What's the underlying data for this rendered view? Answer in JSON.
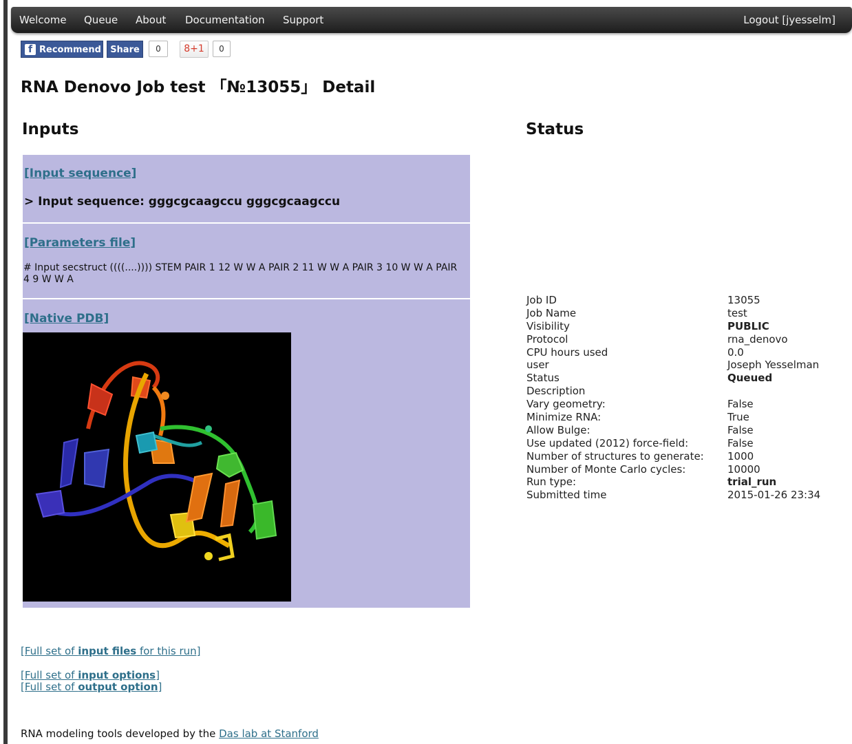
{
  "nav": {
    "items": [
      "Welcome",
      "Queue",
      "About",
      "Documentation",
      "Support"
    ],
    "logout": "Logout [jyesselm]"
  },
  "social": {
    "fb_logo": "f",
    "recommend_label": "Recommend",
    "share_label": "Share",
    "fb_count": "0",
    "gplus_label": "8+1",
    "gplus_count": "0"
  },
  "page_title": "RNA Denovo Job test 「№13055」 Detail",
  "inputs": {
    "heading": "Inputs",
    "sequence_link": "[Input sequence]",
    "sequence_line": "> Input sequence: gggcgcaagccu gggcgcaagccu",
    "params_link": "[Parameters file]",
    "params_text": "# Input secstruct ((((....)))) STEM PAIR 1 12 W W A PAIR 2 11 W W A PAIR 3 10 W W A PAIR 4 9 W W A",
    "pdb_link": "[Native PDB]"
  },
  "links": {
    "input_files": {
      "pre": "[Full set of ",
      "bold": "input files",
      "post": " for this run]"
    },
    "input_options": {
      "pre": "[Full set of ",
      "bold": "input options",
      "post": "]"
    },
    "output_option": {
      "pre": "[Full set of ",
      "bold": "output option",
      "post": "]"
    }
  },
  "credits": {
    "text": "RNA modeling tools developed by the ",
    "link": "Das lab at Stanford"
  },
  "status": {
    "heading": "Status",
    "rows": [
      {
        "label": "Job ID",
        "value": "13055"
      },
      {
        "label": "Job Name",
        "value": "test"
      },
      {
        "label": "Visibility",
        "value": "PUBLIC"
      },
      {
        "label": "Protocol",
        "value": "rna_denovo"
      },
      {
        "label": "CPU hours used",
        "value": "0.0"
      },
      {
        "label": "user",
        "value": "Joseph Yesselman"
      },
      {
        "label": "Status",
        "value": "Queued"
      },
      {
        "label": "Description",
        "value": ""
      },
      {
        "label": "Vary geometry:",
        "value": "False"
      },
      {
        "label": "Minimize RNA:",
        "value": "True"
      },
      {
        "label": "Allow Bulge:",
        "value": "False"
      },
      {
        "label": "Use updated (2012) force-field:",
        "value": "False"
      },
      {
        "label": "Number of structures to generate:",
        "value": "1000"
      },
      {
        "label": "Number of Monte Carlo cycles:",
        "value": "10000"
      },
      {
        "label": "Run type:",
        "value": "trial_run"
      },
      {
        "label": "Submitted time",
        "value": "2015-01-26 23:34"
      }
    ]
  }
}
